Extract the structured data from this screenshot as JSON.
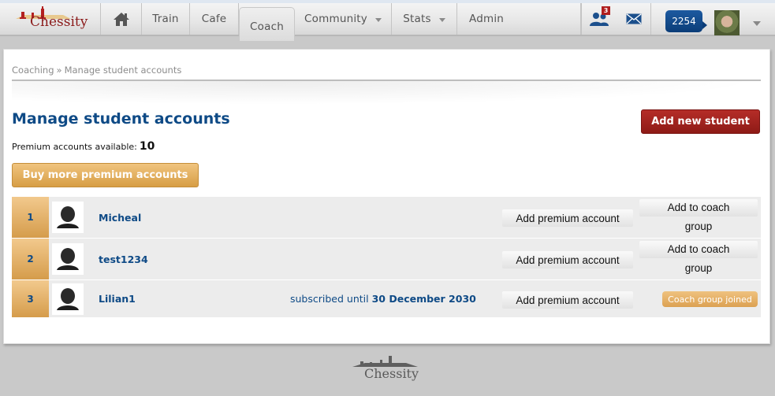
{
  "brand": {
    "name": "Chessity"
  },
  "nav": {
    "home_icon": "home-icon",
    "items": [
      {
        "label": "Train",
        "has_dropdown": false,
        "active": false
      },
      {
        "label": "Cafe",
        "has_dropdown": false,
        "active": false
      },
      {
        "label": "Coach",
        "has_dropdown": false,
        "active": true
      },
      {
        "label": "Community",
        "has_dropdown": true,
        "active": false
      },
      {
        "label": "Stats",
        "has_dropdown": true,
        "active": false
      },
      {
        "label": "Admin",
        "has_dropdown": false,
        "active": false
      }
    ],
    "friends_icon": "friends-icon",
    "friend_requests_count": "3",
    "messages_icon": "envelope-icon",
    "rating": "2254",
    "user_menu_icon": "caret-down-icon"
  },
  "breadcrumb": {
    "items": [
      "Coaching",
      "Manage student accounts"
    ],
    "separator": "»"
  },
  "page": {
    "title": "Manage student accounts",
    "add_student_label": "Add new student",
    "premium_label": "Premium accounts available:",
    "premium_count": "10",
    "buy_more_label": "Buy more premium accounts"
  },
  "students": [
    {
      "rank": "1",
      "name": "Micheal",
      "subscription_prefix": "",
      "subscription_date": "",
      "premium_button": "Add premium account",
      "coach_button_line1": "Add to coach",
      "coach_button_line2": "group",
      "coach_status": ""
    },
    {
      "rank": "2",
      "name": "test1234",
      "subscription_prefix": "",
      "subscription_date": "",
      "premium_button": "Add premium account",
      "coach_button_line1": "Add to coach",
      "coach_button_line2": "group",
      "coach_status": ""
    },
    {
      "rank": "3",
      "name": "Lilian1",
      "subscription_prefix": "subscribed until",
      "subscription_date": "30 December 2030",
      "premium_button": "Add premium account",
      "coach_button_line1": "",
      "coach_button_line2": "",
      "coach_status": "Coach group joined"
    }
  ],
  "colors": {
    "brand_red": "#8b1a1a",
    "link_blue": "#0e4a86",
    "accent_gold": "#d79e45",
    "danger_red": "#a32320"
  }
}
